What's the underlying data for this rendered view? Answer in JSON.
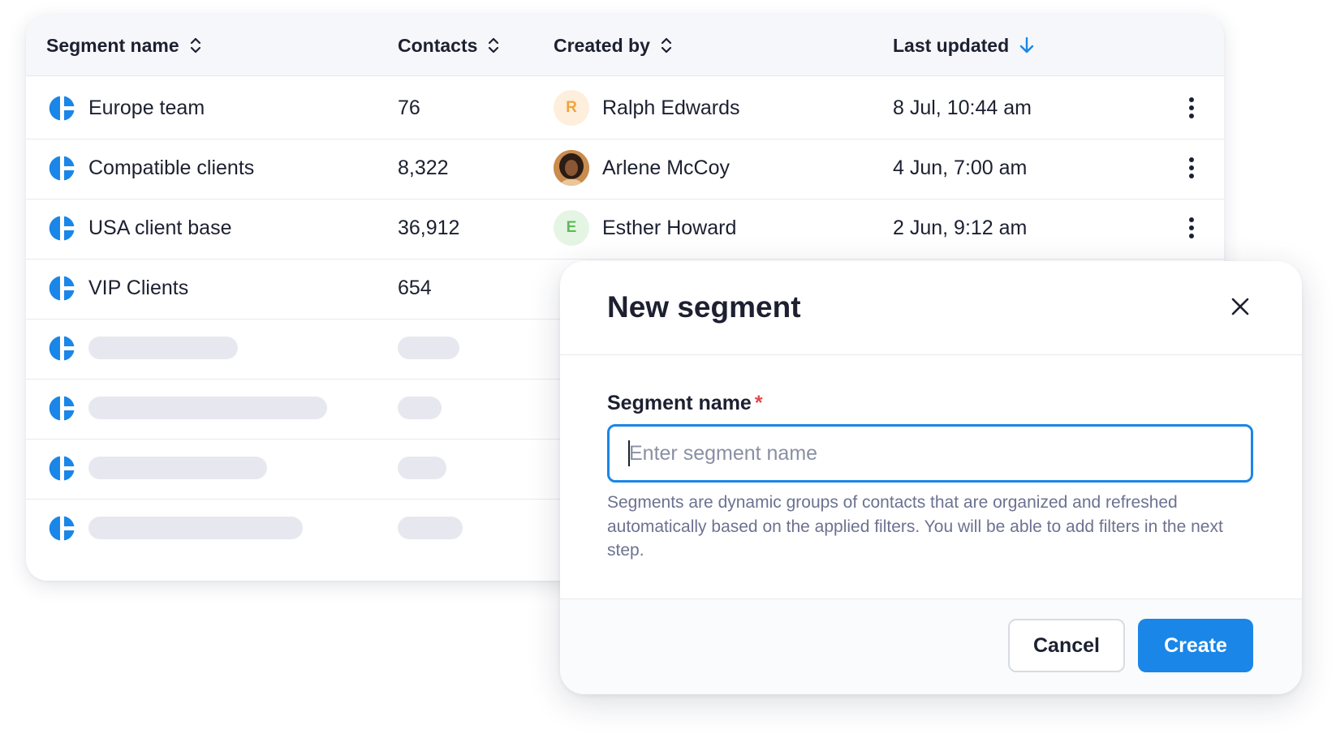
{
  "table": {
    "columns": {
      "segment_name": "Segment name",
      "contacts": "Contacts",
      "created_by": "Created by",
      "last_updated": "Last updated"
    },
    "rows": [
      {
        "name": "Europe team",
        "contacts": "76",
        "creator": "Ralph Edwards",
        "creator_initial": "R",
        "updated": "8 Jul, 10:44 am"
      },
      {
        "name": "Compatible clients",
        "contacts": "8,322",
        "creator": "Arlene McCoy",
        "creator_initial": "",
        "updated": "4 Jun, 7:00 am"
      },
      {
        "name": "USA client base",
        "contacts": "36,912",
        "creator": "Esther Howard",
        "creator_initial": "E",
        "updated": "2 Jun, 9:12 am"
      },
      {
        "name": "VIP Clients",
        "contacts": "654",
        "creator": "",
        "creator_initial": "",
        "updated": ""
      }
    ]
  },
  "modal": {
    "title": "New segment",
    "field_label": "Segment name",
    "required_mark": "*",
    "input_value": "",
    "input_placeholder": "Enter segment name",
    "helper_text": "Segments are dynamic groups of contacts that are organized and refreshed automatically based on the applied filters. You will be able to add filters in the next step.",
    "cancel_label": "Cancel",
    "create_label": "Create"
  },
  "icons": {
    "segment": "segment-pie-icon",
    "sort": "sort-updown-icon",
    "sort_desc": "arrow-down-icon",
    "row_menu": "kebab-menu-icon",
    "close": "close-icon"
  },
  "colors": {
    "accent": "#1a86e8",
    "required": "#e5484d",
    "avatar_r_bg": "#fdefdc",
    "avatar_r_fg": "#f1a33b",
    "avatar_e_bg": "#e5f5e4",
    "avatar_e_fg": "#62b85a",
    "skeleton": "#e7e8ef"
  }
}
